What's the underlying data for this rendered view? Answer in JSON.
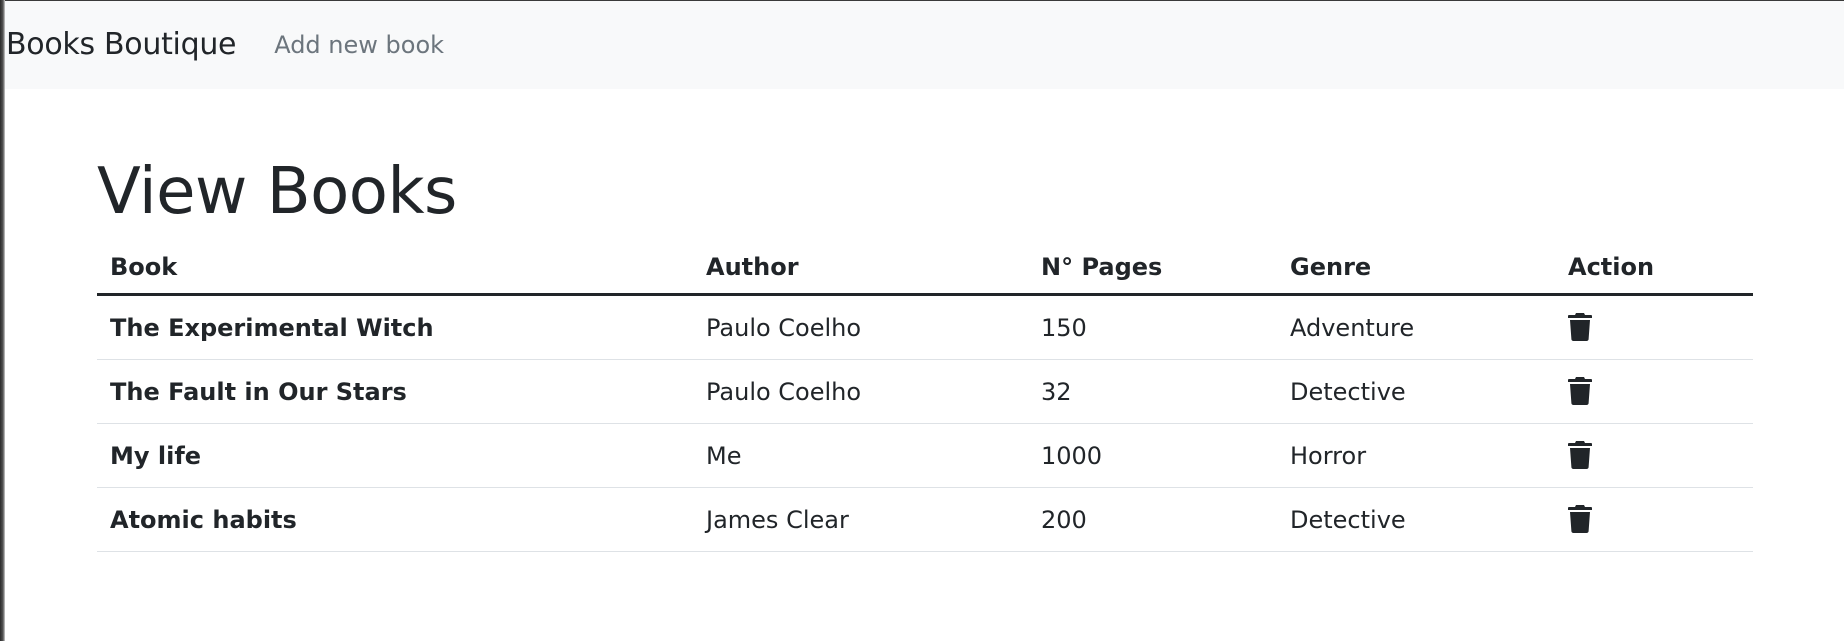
{
  "navbar": {
    "brand": "Books Boutique",
    "links": [
      {
        "label": "Add new book"
      }
    ]
  },
  "main": {
    "title": "View Books",
    "table": {
      "headers": [
        "Book",
        "Author",
        "N° Pages",
        "Genre",
        "Action"
      ],
      "rows": [
        {
          "book": "The Experimental Witch",
          "author": "Paulo Coelho",
          "pages": "150",
          "genre": "Adventure",
          "action_icon": "trash-icon"
        },
        {
          "book": "The Fault in Our Stars",
          "author": "Paulo Coelho",
          "pages": "32",
          "genre": "Detective",
          "action_icon": "trash-icon"
        },
        {
          "book": "My life",
          "author": "Me",
          "pages": "1000",
          "genre": "Horror",
          "action_icon": "trash-icon"
        },
        {
          "book": "Atomic habits",
          "author": "James Clear",
          "pages": "200",
          "genre": "Detective",
          "action_icon": "trash-icon"
        }
      ]
    }
  },
  "colors": {
    "navbar_bg": "#f8f9fa",
    "text": "#212529",
    "muted_link": "#6c757d",
    "row_border": "#dee2e6"
  }
}
